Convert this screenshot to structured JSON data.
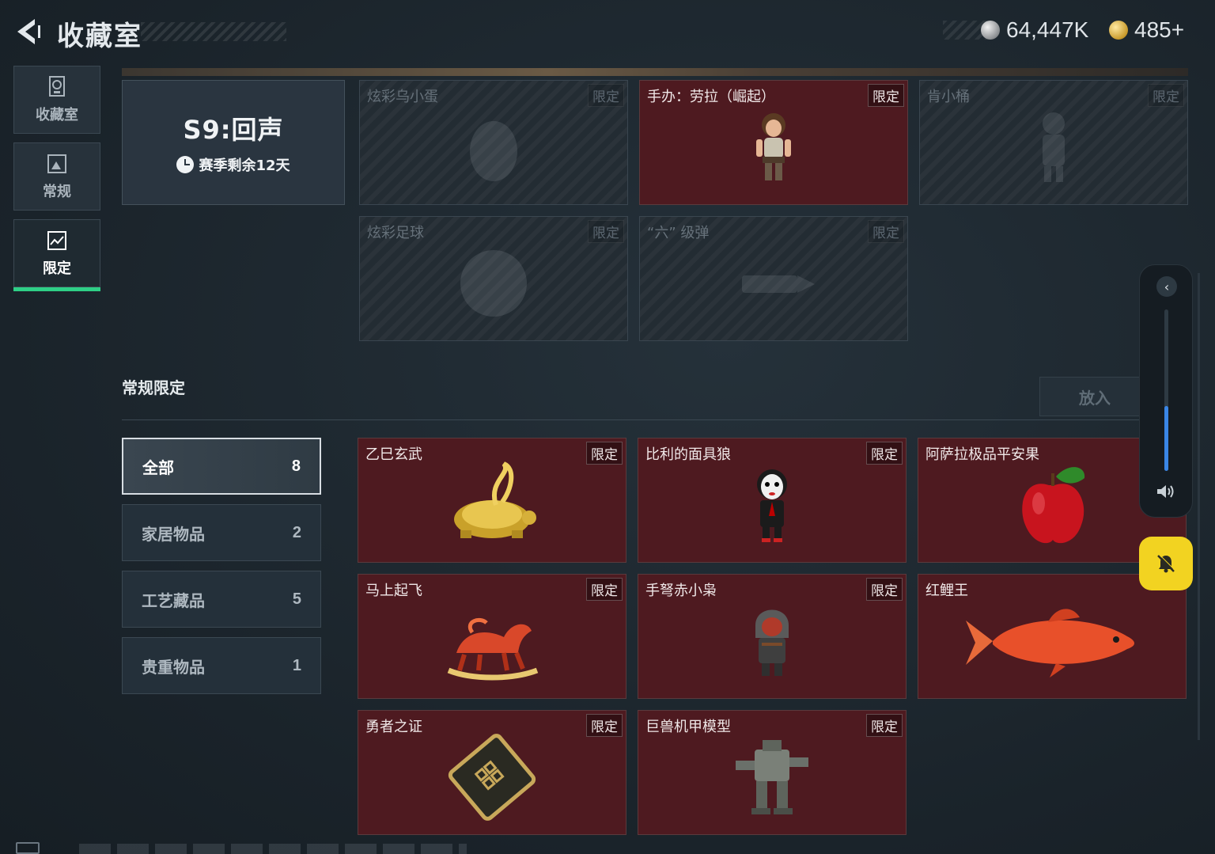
{
  "header": {
    "title": "收藏室",
    "currency_silver": "64,447K",
    "currency_gold": "485+"
  },
  "nav": [
    {
      "label": "收藏室",
      "icon": "trophy-icon"
    },
    {
      "label": "常规",
      "icon": "picture-icon"
    },
    {
      "label": "限定",
      "icon": "limited-picture-icon",
      "active": true
    }
  ],
  "season": {
    "title": "S9:回声",
    "remaining": "赛季剩余12天"
  },
  "season_items": [
    {
      "name": "炫彩乌小蛋",
      "badge": "限定",
      "locked": true,
      "icon": "egg-icon"
    },
    {
      "name": "手办：劳拉（崛起）",
      "badge": "限定",
      "locked": false,
      "icon": "figurine-icon"
    },
    {
      "name": "肯小桶",
      "badge": "限定",
      "locked": true,
      "icon": "figurine-icon"
    },
    {
      "name": "炫彩足球",
      "badge": "限定",
      "locked": true,
      "icon": "football-icon"
    },
    {
      "name": "“六” 级弹",
      "badge": "限定",
      "locked": true,
      "icon": "bullet-icon"
    }
  ],
  "section": {
    "title": "常规限定",
    "place_label": "放入"
  },
  "filters": [
    {
      "label": "全部",
      "count": "8",
      "active": true
    },
    {
      "label": "家居物品",
      "count": "2"
    },
    {
      "label": "工艺藏品",
      "count": "5"
    },
    {
      "label": "贵重物品",
      "count": "1"
    }
  ],
  "items": [
    {
      "name": "乙巳玄武",
      "badge": "限定",
      "icon": "golden-turtle-icon"
    },
    {
      "name": "比利的面具狼",
      "badge": "限定",
      "icon": "masked-doll-icon"
    },
    {
      "name": "阿萨拉极品平安果",
      "badge": "",
      "icon": "apple-icon"
    },
    {
      "name": "马上起飞",
      "badge": "限定",
      "icon": "rocking-horse-icon"
    },
    {
      "name": "手弩赤小枭",
      "badge": "限定",
      "icon": "hooded-figure-icon"
    },
    {
      "name": "红鲤王",
      "badge": "",
      "icon": "carp-icon"
    },
    {
      "name": "勇者之证",
      "badge": "限定",
      "icon": "card-icon"
    },
    {
      "name": "巨兽机甲模型",
      "badge": "限定",
      "icon": "mech-icon"
    }
  ],
  "volume": {
    "level": 0.4
  },
  "colors": {
    "accent_green": "#2ecf86",
    "card_red": "#4e1a20",
    "mute_yellow": "#f2d321",
    "volume_blue": "#3a86e6"
  }
}
